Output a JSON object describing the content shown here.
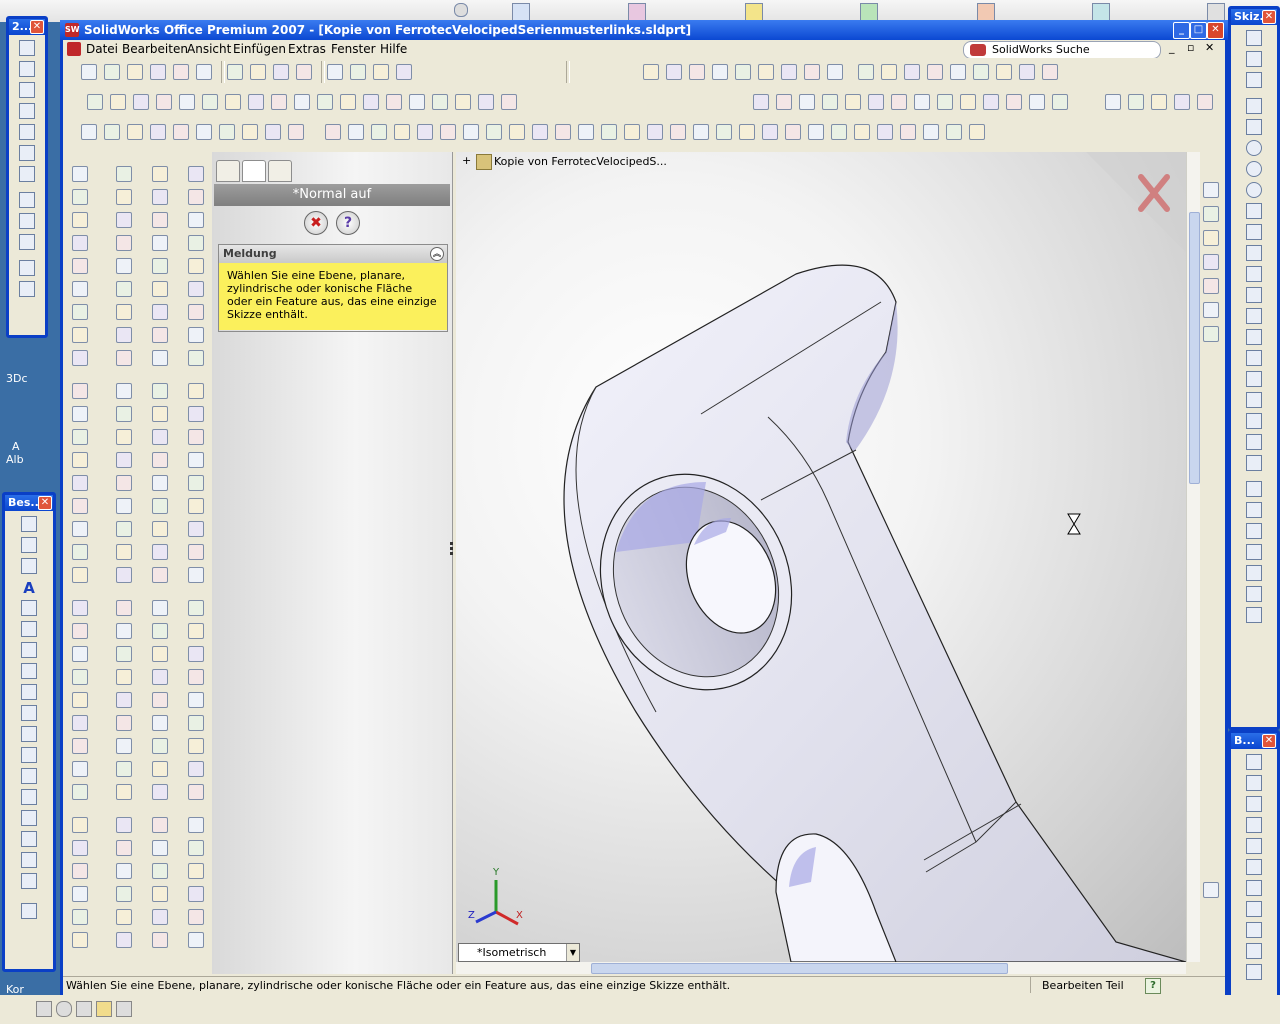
{
  "window": {
    "title": "SolidWorks Office Premium 2007 - [Kopie von FerrotecVelocipedSerienmusterlinks.sldprt]",
    "app_icon": "SW",
    "controls": {
      "minimize": "_",
      "maximize": "□",
      "close": "✕"
    }
  },
  "menu": {
    "items": [
      "Datei",
      "Bearbeiten",
      "Ansicht",
      "Einfügen",
      "Extras",
      "Fenster",
      "Hilfe"
    ],
    "search_label": "SolidWorks Suche",
    "doc_controls": {
      "minimize": "_",
      "restore": "▫",
      "close": "✕"
    }
  },
  "floating_toolbars": {
    "top_left": {
      "title": "2...",
      "close": "✕"
    },
    "bottom_left": {
      "title": "Bes...",
      "close": "✕"
    },
    "right_top": {
      "title": "Skiz...",
      "close": "✕"
    },
    "right_bottom": {
      "title": "B...",
      "close": "✕"
    }
  },
  "desktop": {
    "labels": [
      "3Dc",
      "A",
      "Alb",
      "Kor"
    ]
  },
  "property_manager": {
    "header": "*Normal auf",
    "ok_symbol": "✖",
    "help_symbol": "?",
    "group_title": "Meldung",
    "collapse_symbol": "︽",
    "message": "Wählen Sie eine Ebene, planare, zylindrische oder konische Fläche oder ein Feature aus, das eine einzige Skizze enthält."
  },
  "graphics": {
    "tree_root": "Kopie von FerrotecVelocipedS...",
    "tree_expand": "+",
    "view_orientation": "*Isometrisch",
    "triad": {
      "x": "X",
      "y": "Y",
      "z": "Z"
    }
  },
  "status_bar": {
    "message": "Wählen Sie eine Ebene, planare, zylindrische oder konische Fläche oder ein Feature aus, das eine einzige Skizze enthält.",
    "mode": "Bearbeiten Teil",
    "help": "?"
  }
}
